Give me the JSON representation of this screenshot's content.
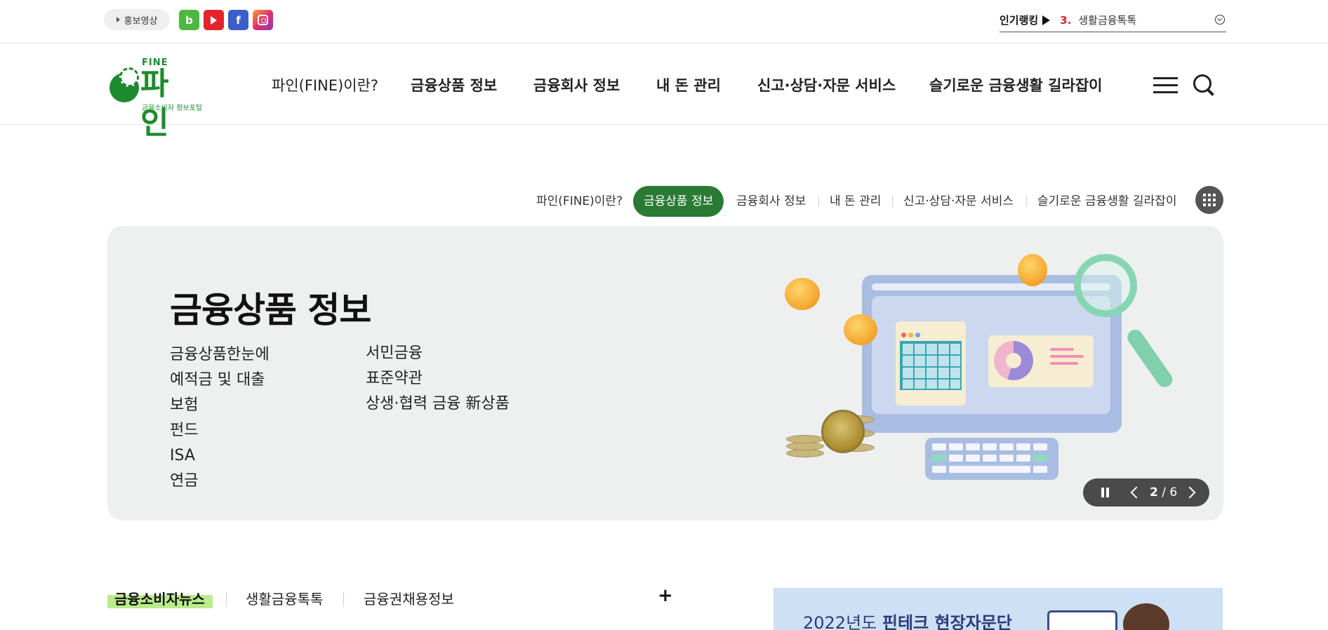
{
  "topbar": {
    "promo_label": "홍보영상",
    "social": [
      {
        "icon": "blog-icon",
        "label": "b",
        "color": "#4cb840"
      },
      {
        "icon": "youtube-icon",
        "color": "#e3242b"
      },
      {
        "icon": "facebook-icon",
        "label": "f",
        "color": "#3b5ec8"
      },
      {
        "icon": "instagram-icon",
        "color": "#e1306c"
      }
    ],
    "ranking": {
      "label": "인기랭킹",
      "rank": "3.",
      "title": "생활금융톡톡"
    }
  },
  "header": {
    "logo": {
      "fine": "FINE",
      "name": "파인",
      "sub": "금융소비자 정보포털",
      "color": "#1e8a2e"
    },
    "gnb": [
      {
        "label": "파인(FINE)이란?"
      },
      {
        "label": "금융상품 정보"
      },
      {
        "label": "금융회사 정보"
      },
      {
        "label": "내 돈 관리"
      },
      {
        "label": "신고·상담·자문 서비스"
      },
      {
        "label": "슬기로운 금융생활 길라잡이"
      }
    ]
  },
  "subnav": {
    "items": [
      {
        "label": "파인(FINE)이란?"
      },
      {
        "label": "금융상품 정보",
        "active": true
      },
      {
        "label": "금융회사 정보"
      },
      {
        "label": "내 돈 관리"
      },
      {
        "label": "신고·상담·자문 서비스"
      },
      {
        "label": "슬기로운 금융생활 길라잡이"
      }
    ],
    "active_color": "#2a7a33"
  },
  "banner": {
    "title": "금융상품 정보",
    "links_col1": [
      "금융상품한눈에",
      "예적금 및 대출",
      "보험",
      "펀드",
      "ISA",
      "연금"
    ],
    "links_col2": [
      "서민금융",
      "표준약관",
      "상생·협력 금융 新상품"
    ],
    "slide_current": "2",
    "slide_separator": "/",
    "slide_total": "6",
    "background": "#eeefef"
  },
  "news": {
    "tabs": [
      {
        "label": "금융소비자뉴스",
        "active": true
      },
      {
        "label": "생활금융톡톡"
      },
      {
        "label": "금융권채용정보"
      }
    ],
    "more_label": "+",
    "highlight_color": "#b9ec8a"
  },
  "promo_banner": {
    "text_prefix": "2022년도",
    "text_bold": "핀테크 현장자문단"
  }
}
